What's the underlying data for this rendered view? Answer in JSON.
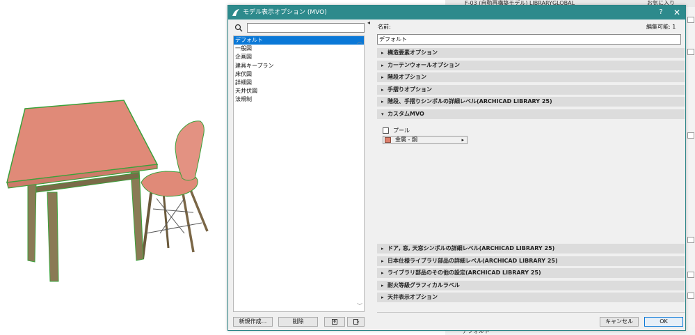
{
  "colors": {
    "title_bar": "#2d8a8c",
    "selection": "#0a78d7",
    "table_top": "#e08a78",
    "material_swatch": "#dd7e6b",
    "outline_green": "#3aa13a"
  },
  "background_app": {
    "top_strip_text": "F-03 (自動再構築モデル)   LIBRARYGLOBAL",
    "right_top_text": "お気に入り",
    "bottom_text": "デフォルト"
  },
  "dialog": {
    "title": "モデル表示オプション (MVO)",
    "help_label": "?",
    "close_label": "✕",
    "search": {
      "value": "",
      "placeholder": ""
    },
    "list_items": [
      "デフォルト",
      "一般図",
      "企画図",
      "建具キープラン",
      "床伏図",
      "詳細図",
      "天井伏図",
      "法規制"
    ],
    "selected_index": 0,
    "buttons": {
      "new": "新規作成...",
      "delete": "削除",
      "ok": "OK",
      "cancel": "キャンセル"
    },
    "name_label": "名前:",
    "editable_label": "編集可能: 1",
    "name_value": "デフォルト",
    "sections_top": [
      {
        "label": "構造要素オプション",
        "expanded": false
      },
      {
        "label": "カーテンウォールオプション",
        "expanded": false
      },
      {
        "label": "階段オプション",
        "expanded": false
      },
      {
        "label": "手摺りオプション",
        "expanded": false
      },
      {
        "label": "階段、手摺りシンボルの詳細レベル(ARCHICAD LIBRARY 25)",
        "expanded": false
      },
      {
        "label": "カスタムMVO",
        "expanded": true
      }
    ],
    "custom_mvo": {
      "checkbox_label": "プール",
      "checkbox_checked": false,
      "material_name": "金属 - 鋼"
    },
    "sections_bottom": [
      {
        "label": "ドア, 窓, 天窓シンボルの詳細レベル(ARCHICAD LIBRARY 25)",
        "expanded": false
      },
      {
        "label": "日本仕様ライブラリ部品の詳細レベル(ARCHICAD LIBRARY 25)",
        "expanded": false
      },
      {
        "label": "ライブラリ部品のその他の設定(ARCHICAD LIBRARY 25)",
        "expanded": false
      },
      {
        "label": "耐火等級グラフィカルラベル",
        "expanded": false
      },
      {
        "label": "天井表示オプション",
        "expanded": false
      }
    ]
  }
}
